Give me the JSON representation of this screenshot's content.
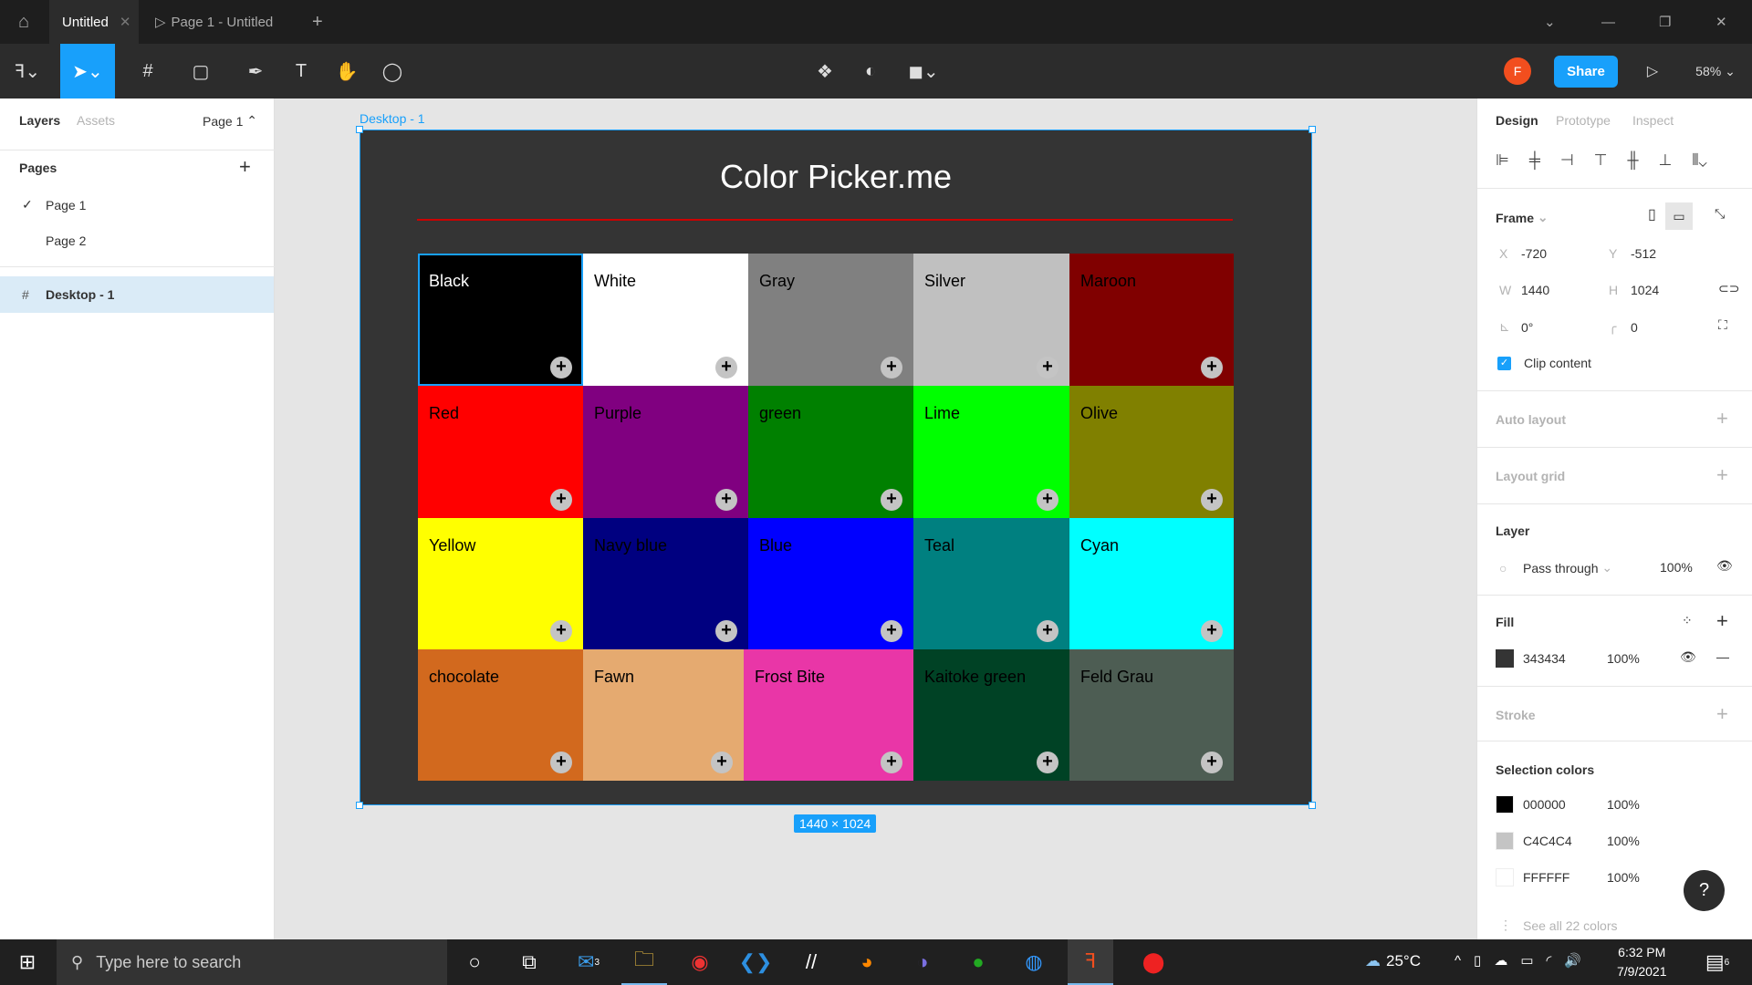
{
  "titlebar": {
    "tabs": [
      {
        "label": "Untitled"
      },
      {
        "label": "Page 1 - Untitled"
      }
    ]
  },
  "toolbar": {
    "share": "Share",
    "zoom": "58%",
    "avatar": "F"
  },
  "left": {
    "tabs": [
      "Layers",
      "Assets"
    ],
    "page_selector": "Page 1",
    "pages_title": "Pages",
    "pages": [
      "Page 1",
      "Page 2"
    ],
    "layer": "Desktop - 1"
  },
  "canvas": {
    "frame_label": "Desktop - 1",
    "size_label": "1440 × 1024",
    "title": "Color Picker.me",
    "cells": [
      {
        "name": "Black",
        "color": "#000000",
        "text": "#ffffff"
      },
      {
        "name": "White",
        "color": "#ffffff",
        "text": "#000000"
      },
      {
        "name": "Gray",
        "color": "#808080",
        "text": "#000000"
      },
      {
        "name": "Silver",
        "color": "#c0c0c0",
        "text": "#000000"
      },
      {
        "name": "Maroon",
        "color": "#800000",
        "text": "#000000"
      },
      {
        "name": "Red",
        "color": "#ff0000",
        "text": "#000000"
      },
      {
        "name": "Purple",
        "color": "#800080",
        "text": "#000000"
      },
      {
        "name": "green",
        "color": "#008000",
        "text": "#000000"
      },
      {
        "name": "Lime",
        "color": "#00ff00",
        "text": "#000000"
      },
      {
        "name": "Olive",
        "color": "#808000",
        "text": "#000000"
      },
      {
        "name": "Yellow",
        "color": "#ffff00",
        "text": "#000000"
      },
      {
        "name": "Navy blue",
        "color": "#000080",
        "text": "#000000"
      },
      {
        "name": "Blue",
        "color": "#0000ff",
        "text": "#000000"
      },
      {
        "name": "Teal",
        "color": "#008080",
        "text": "#000000"
      },
      {
        "name": "Cyan",
        "color": "#00ffff",
        "text": "#000000"
      },
      {
        "name": "chocolate",
        "color": "#d2691e",
        "text": "#000000"
      },
      {
        "name": "Fawn",
        "color": "#e5aa70",
        "text": "#000000"
      },
      {
        "name": "Frost Bite",
        "color": "#e936a7",
        "text": "#000000"
      },
      {
        "name": "Kaitoke green",
        "color": "#004225",
        "text": "#000000"
      },
      {
        "name": "Feld Grau",
        "color": "#4d5d53",
        "text": "#000000"
      }
    ]
  },
  "right": {
    "tabs": [
      "Design",
      "Prototype",
      "Inspect"
    ],
    "frame": "Frame",
    "x_label": "X",
    "x": "-720",
    "y_label": "Y",
    "y": "-512",
    "w_label": "W",
    "w": "1440",
    "h_label": "H",
    "h": "1024",
    "rotation": "0°",
    "radius": "0",
    "clip": "Clip content",
    "auto_layout": "Auto layout",
    "layout_grid": "Layout grid",
    "layer": "Layer",
    "blend": "Pass through",
    "layer_opacity": "100%",
    "fill": "Fill",
    "fill_hex": "343434",
    "fill_opacity": "100%",
    "fill_color": "#343434",
    "stroke": "Stroke",
    "selection_colors": "Selection colors",
    "colors": [
      {
        "hex": "000000",
        "opacity": "100%",
        "color": "#000000"
      },
      {
        "hex": "C4C4C4",
        "opacity": "100%",
        "color": "#c4c4c4"
      },
      {
        "hex": "FFFFFF",
        "opacity": "100%",
        "color": "#ffffff"
      }
    ],
    "see_all": "See all 22 colors",
    "help": "?"
  },
  "taskbar": {
    "search": "Type here to search",
    "weather": "25°C",
    "time": "6:32 PM",
    "date": "7/9/2021",
    "mail_badge": "3",
    "notif_badge": "6"
  }
}
